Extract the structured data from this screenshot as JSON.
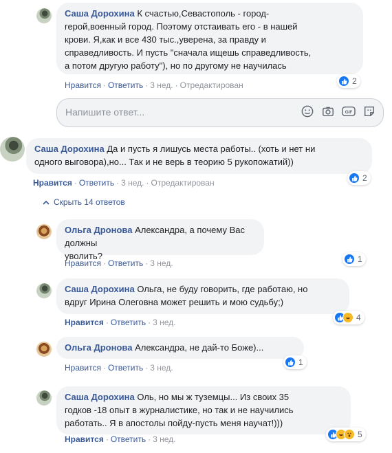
{
  "colors": {
    "link": "#385898",
    "bubble": "#f2f3f5",
    "like": "#1877f2",
    "meta": "#90949c"
  },
  "actions": {
    "like": "Нравится",
    "reply": "Ответить"
  },
  "reply_box": {
    "placeholder": "Напишите ответ..."
  },
  "hide_replies": "Скрыть 14 ответов",
  "comments": [
    {
      "author": "Саша Дорохина",
      "lines": [
        "К счастью,Севастополь - город-",
        "герой,военный город. Поэтому отстаивать его - в нашей",
        "крови. Я,как и все 430 тыс.,уверена, за правду и",
        "справедливость. И пусть \"сначала ищешь справедливость,",
        "а потом другую работу\"), но по другому не научилась"
      ],
      "time": "3 нед.",
      "edited": "Отредактирован",
      "reactions": [
        "like"
      ],
      "reaction_count": "2"
    },
    {
      "author": "Саша Дорохина",
      "lines": [
        "Да и пусть я лишусь места работы.. (хоть и нет ни",
        "одного выговора),но... Так и не верь в теорию 5 рукопожатий))"
      ],
      "time": "3 нед.",
      "edited": "Отредактирован",
      "reactions": [
        "like"
      ],
      "reaction_count": "2"
    },
    {
      "author": "Ольга Дронова",
      "lines": [
        "Александра, а почему Вас должны",
        "уволить?"
      ],
      "time": "3 нед.",
      "reactions": [
        "like"
      ],
      "reaction_count": "1"
    },
    {
      "author": "Саша Дорохина",
      "lines": [
        "Ольга, не буду говорить, где работаю, но",
        "вдруг Ирина Олеговна может решить и мою судьбу;)"
      ],
      "time": "3 нед.",
      "reactions": [
        "like",
        "haha"
      ],
      "reaction_count": "4"
    },
    {
      "author": "Ольга Дронова",
      "lines": [
        "Александра, не дай-то Боже)..."
      ],
      "time": "3 нед.",
      "reactions": [
        "like"
      ],
      "reaction_count": "1"
    },
    {
      "author": "Саша Дорохина",
      "lines": [
        "Оль, но мы ж туземцы... Из своих 35",
        "годков -18 опыт в журналистике, но так и не научились",
        "работать.. Я в апостолы пойду-пусть меня научат!)))"
      ],
      "time": "3 нед.",
      "reactions": [
        "like",
        "haha",
        "wow"
      ],
      "reaction_count": "5"
    }
  ]
}
